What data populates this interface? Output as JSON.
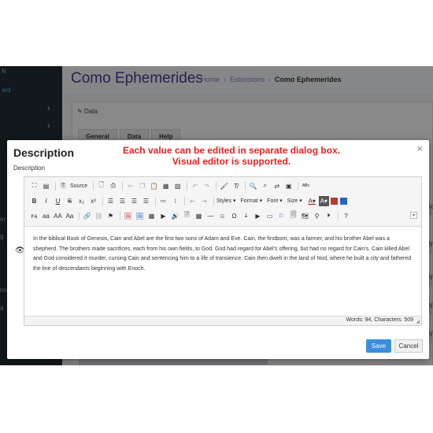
{
  "background": {
    "app_title": "Como Ephemerides",
    "breadcrumb": {
      "home": "Home",
      "extensions": "Extensions",
      "current": "Como Ephemerides"
    },
    "sidebar": {
      "text_top": "N",
      "active_item": "ard",
      "item_a": "er",
      "item_b": "g",
      "item_c": "no",
      "item_d": "a"
    },
    "panel_heading": "Data",
    "tabs": [
      "General",
      "Data",
      "Help"
    ],
    "right_fragments": [
      "Ac",
      "W",
      "W",
      "W",
      "W"
    ]
  },
  "modal": {
    "title": "Description",
    "subtitle": "Description",
    "promo_line1": "Each value can be edited in separate dialog box.",
    "promo_line2": "Visual editor is supported.",
    "close": "×",
    "save_label": "Save",
    "cancel_label": "Cancel"
  },
  "editor": {
    "toolbar": {
      "source_label": "Source",
      "styles_label": "Styles",
      "format_label": "Format",
      "font_label": "Font",
      "size_label": "Size",
      "collapse": "▾"
    },
    "content": "In the biblical Book of Genesis, Cain and Abel are the first two sons of Adam and Eve. Cain, the firstborn, was a farmer, and his brother Abel was a shepherd. The brothers made sacrifices, each from his own fields, to God. God had regard for Abel's offering, but had no regard for Cain's. Cain killed Abel and God considered it murder, cursing Cain and sentencing him to a life of transience. Cain then dwelt in the land of Nod, where he built a city and fathered the line of descendants beginning with Enoch.",
    "status": "Words: 94, Characters: 509"
  },
  "colors": {
    "accent": "#3b8ede",
    "promo": "#e02424",
    "title": "#4b3a8c",
    "sidebar": "#222d32"
  }
}
